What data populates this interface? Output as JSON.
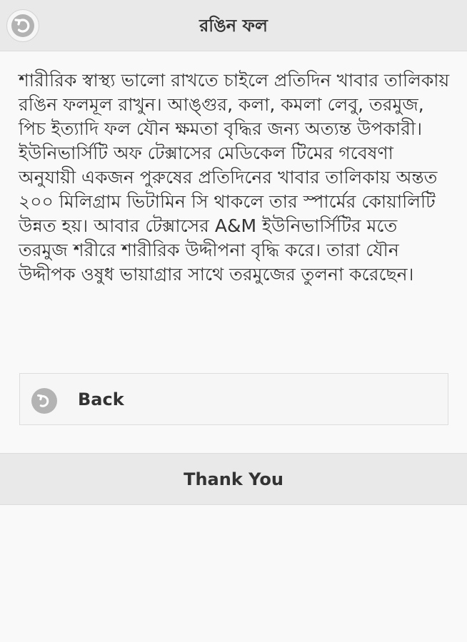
{
  "header": {
    "title": "রঙিন ফল",
    "back_icon": "back-arrow-icon"
  },
  "article": {
    "text": "শারীরিক স্বাস্থ্য ভালো রাখতে চাইলে প্রতিদিন খাবার তালিকায় রঙিন ফলমূল রাখুন। আঙ্গুর, কলা, কমলা লেবু, তরমুজ, পিচ ইত্যাদি ফল যৌন ক্ষমতা বৃদ্ধির জন্য অত্যন্ত উপকারী। ইউনিভার্সিটি অফ টেক্সাসের মেডিকেল টিমের গবেষণা অনুযায়ী একজন পুরুষের প্রতিদিনের খাবার তালিকায় অন্তত ২০০ মিলিগ্রাম ভিটামিন সি থাকলে তার স্পার্মের কোয়ালিটি উন্নত হয়। আবার টেক্সাসের A&M ইউনিভার্সিটির মতে তরমুজ শরীরে শারীরিক উদ্দীপনা বৃদ্ধি করে। তারা যৌন উদ্দীপক ওষুধ ভায়াগ্রার সাথে তরমুজের তুলনা করেছেন।"
  },
  "back_button": {
    "label": "Back",
    "icon": "back-arrow-icon"
  },
  "footer": {
    "title": "Thank You"
  },
  "colors": {
    "bar_background": "#e9e9e9",
    "page_background": "#f9f9f9",
    "icon_disc": "#b3b3b3",
    "text": "#333333"
  }
}
